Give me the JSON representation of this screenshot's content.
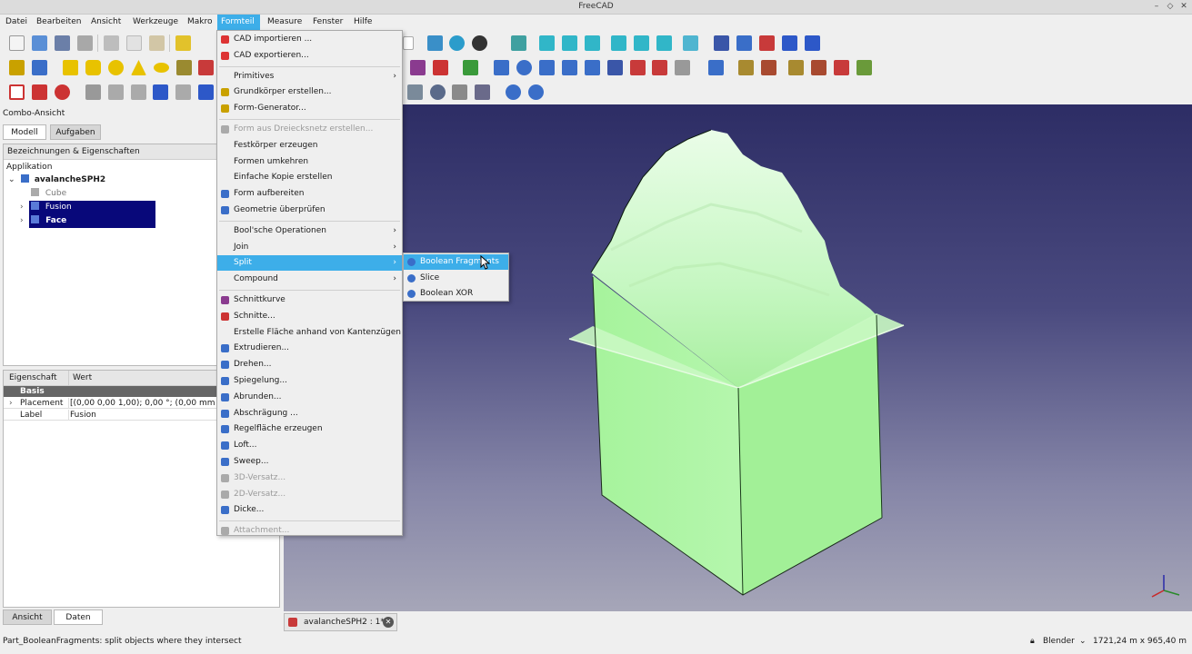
{
  "window": {
    "title": "FreeCAD"
  },
  "menubar": [
    "Datei",
    "Bearbeiten",
    "Ansicht",
    "Werkzeuge",
    "Makro",
    "Formteil",
    "Measure",
    "Fenster",
    "Hilfe"
  ],
  "combo": {
    "title": "Combo-Ansicht",
    "tabs": [
      "Modell",
      "Aufgaben"
    ],
    "tree_header": "Bezeichnungen & Eigenschaften",
    "tree_root": "Applikation",
    "doc": "avalancheSPH2",
    "items": [
      "Cube",
      "Fusion",
      "Face"
    ]
  },
  "properties": {
    "col_property": "Eigenschaft",
    "col_value": "Wert",
    "group": "Basis",
    "rows": [
      {
        "name": "Placement",
        "value": "[(0,00 0,00 1,00); 0,00 °; (0,00 mm  0,0"
      },
      {
        "name": "Label",
        "value": "Fusion"
      }
    ]
  },
  "bottom_tabs": [
    "Ansicht",
    "Daten"
  ],
  "document_tab": "avalancheSPH2 : 1*",
  "status": {
    "message": "Part_BooleanFragments: split objects where they intersect",
    "nav_style": "Blender",
    "dimensions": "1721,24 m x 965,40 m"
  },
  "formteil_menu": [
    {
      "label": "CAD importieren ...",
      "icon": "cad-import-icon",
      "color": "#d33"
    },
    {
      "label": "CAD exportieren...",
      "icon": "cad-export-icon",
      "color": "#d33"
    },
    {
      "sep": true
    },
    {
      "label": "Primitives",
      "submenu": true
    },
    {
      "label": "Grundkörper erstellen...",
      "icon": "primitives-icon",
      "color": "#c9a100"
    },
    {
      "label": "Form-Generator...",
      "icon": "shape-builder-icon",
      "color": "#c9a100"
    },
    {
      "sep": true
    },
    {
      "label": "Form aus Dreiecksnetz erstellen...",
      "disabled": true,
      "icon": "mesh-shape-icon",
      "color": "#aaa"
    },
    {
      "label": "Festkörper erzeugen"
    },
    {
      "label": "Formen umkehren"
    },
    {
      "label": "Einfache Kopie erstellen"
    },
    {
      "label": "Form aufbereiten",
      "icon": "refine-icon",
      "color": "#3a6ec8"
    },
    {
      "label": "Geometrie überprüfen",
      "icon": "check-geometry-icon",
      "color": "#3a6ec8"
    },
    {
      "sep": true
    },
    {
      "label": "Bool'sche Operationen",
      "submenu": true
    },
    {
      "label": "Join",
      "submenu": true
    },
    {
      "label": "Split",
      "submenu": true,
      "highlight": true
    },
    {
      "label": "Compound",
      "submenu": true
    },
    {
      "sep": true
    },
    {
      "label": "Schnittkurve",
      "icon": "section-icon",
      "color": "#8a3b8f"
    },
    {
      "label": "Schnitte...",
      "icon": "cross-sections-icon",
      "color": "#c33"
    },
    {
      "label": "Erstelle Fläche anhand von Kantenzügen"
    },
    {
      "label": "Extrudieren...",
      "icon": "extrude-icon",
      "color": "#3a6ec8"
    },
    {
      "label": "Drehen...",
      "icon": "revolve-icon",
      "color": "#3a6ec8"
    },
    {
      "label": "Spiegelung...",
      "icon": "mirror-icon",
      "color": "#3a6ec8"
    },
    {
      "label": "Abrunden...",
      "icon": "fillet-icon",
      "color": "#3a6ec8"
    },
    {
      "label": "Abschrägung ...",
      "icon": "chamfer-icon",
      "color": "#3a6ec8"
    },
    {
      "label": "Regelfläche erzeugen",
      "icon": "ruled-surface-icon",
      "color": "#3a6ec8"
    },
    {
      "label": "Loft...",
      "icon": "loft-icon",
      "color": "#3a6ec8"
    },
    {
      "label": "Sweep...",
      "icon": "sweep-icon",
      "color": "#3a6ec8"
    },
    {
      "label": "3D-Versatz...",
      "disabled": true,
      "icon": "offset3d-icon",
      "color": "#aaa"
    },
    {
      "label": "2D-Versatz...",
      "disabled": true,
      "icon": "offset2d-icon",
      "color": "#aaa"
    },
    {
      "label": "Dicke...",
      "icon": "thickness-icon",
      "color": "#3a6ec8"
    },
    {
      "sep": true
    },
    {
      "label": "Attachment...",
      "disabled": true,
      "icon": "attachment-icon",
      "color": "#aaa"
    }
  ],
  "split_submenu": [
    {
      "label": "Boolean Fragments",
      "highlight": true,
      "icon": "boolean-fragments-icon"
    },
    {
      "label": "Slice",
      "icon": "slice-icon"
    },
    {
      "label": "Boolean XOR",
      "icon": "boolean-xor-icon"
    }
  ],
  "colors": {
    "accent": "#3daee9",
    "selection": "#08087a",
    "model": "#a4f5a0"
  }
}
